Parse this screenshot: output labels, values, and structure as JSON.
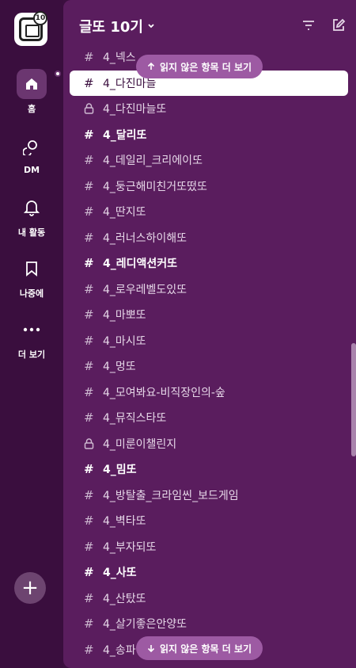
{
  "rail": {
    "workspace_badge": "10",
    "home_label": "홈",
    "dm_label": "DM",
    "activity_label": "내 활동",
    "later_label": "나중에",
    "more_label": "더 보기"
  },
  "header": {
    "workspace_name": "글또 10기"
  },
  "unread_top": {
    "label": "읽지 않은 항목 더 보기"
  },
  "unread_bottom": {
    "label": "읽지 않은 항목 더 보기"
  },
  "channels": [
    {
      "name": "4_넥스",
      "type": "hash",
      "bold": false
    },
    {
      "name": "4_다진마늘",
      "type": "hash",
      "bold": false,
      "selected": true
    },
    {
      "name": "4_다진마늘또",
      "type": "lock",
      "bold": false
    },
    {
      "name": "4_달리또",
      "type": "hash",
      "bold": true
    },
    {
      "name": "4_데일리_크리에이또",
      "type": "hash",
      "bold": false
    },
    {
      "name": "4_둥근해미친거또떴또",
      "type": "hash",
      "bold": false
    },
    {
      "name": "4_딴지또",
      "type": "hash",
      "bold": false
    },
    {
      "name": "4_러너스하이해또",
      "type": "hash",
      "bold": false
    },
    {
      "name": "4_레디액션커또",
      "type": "hash",
      "bold": true
    },
    {
      "name": "4_로우레벨도있또",
      "type": "hash",
      "bold": false
    },
    {
      "name": "4_마뽀또",
      "type": "hash",
      "bold": false
    },
    {
      "name": "4_마시또",
      "type": "hash",
      "bold": false
    },
    {
      "name": "4_멍또",
      "type": "hash",
      "bold": false
    },
    {
      "name": "4_모여봐요-비직장인의-숲",
      "type": "hash",
      "bold": false
    },
    {
      "name": "4_뮤직스타또",
      "type": "hash",
      "bold": false
    },
    {
      "name": "4_미룬이챌린지",
      "type": "lock",
      "bold": false
    },
    {
      "name": "4_밈또",
      "type": "hash",
      "bold": true
    },
    {
      "name": "4_방탈출_크라임씬_보드게임",
      "type": "hash",
      "bold": false
    },
    {
      "name": "4_벽타또",
      "type": "hash",
      "bold": false
    },
    {
      "name": "4_부자되또",
      "type": "hash",
      "bold": false
    },
    {
      "name": "4_사또",
      "type": "hash",
      "bold": true
    },
    {
      "name": "4_산탔또",
      "type": "hash",
      "bold": false
    },
    {
      "name": "4_살기좋은안양또",
      "type": "hash",
      "bold": false
    },
    {
      "name": "4_송파",
      "type": "hash",
      "bold": false
    }
  ]
}
